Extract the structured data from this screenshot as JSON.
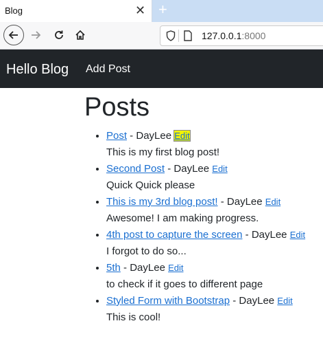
{
  "browser": {
    "tab_title": "Blog",
    "tab_close": "✕",
    "new_tab": "+",
    "url_host": "127.0.0.1",
    "url_port": ":8000"
  },
  "navbar": {
    "brand": "Hello Blog",
    "add_post": "Add Post"
  },
  "page": {
    "heading": "Posts",
    "separator": " - ",
    "edit_label": "Edit",
    "posts": [
      {
        "title": "Post",
        "author": "DayLee",
        "body": "This is my first blog post!"
      },
      {
        "title": "Second Post",
        "author": "DayLee",
        "body": "Quick Quick please"
      },
      {
        "title": "This is my 3rd blog post!",
        "author": "DayLee",
        "body": "Awesome! I am making progress."
      },
      {
        "title": "4th post to capture the screen",
        "author": "DayLee",
        "body": "I forgot to do so..."
      },
      {
        "title": "5th",
        "author": "DayLee",
        "body": "to check if it goes to different page"
      },
      {
        "title": "Styled Form with Bootstrap",
        "author": "DayLee",
        "body": "This is cool!"
      }
    ]
  }
}
